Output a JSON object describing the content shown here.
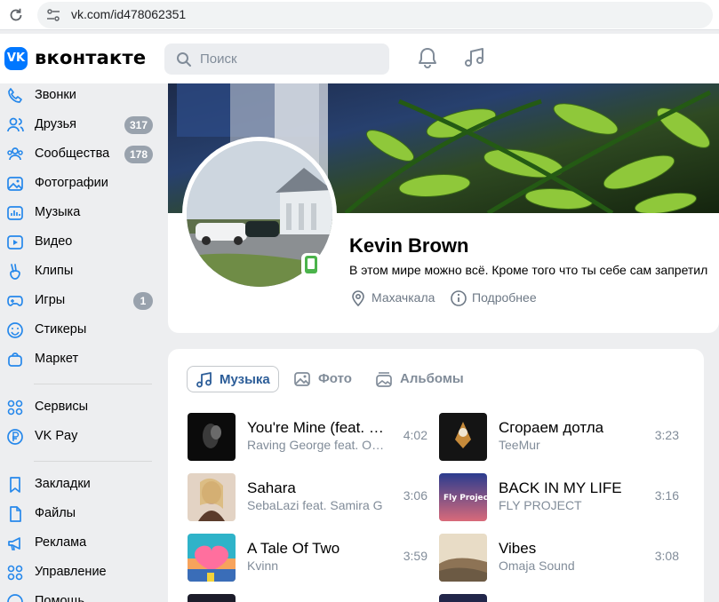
{
  "browser": {
    "url": "vk.com/id478062351"
  },
  "header": {
    "logo_mark": "VK",
    "logo_text": "вконтакте",
    "search_placeholder": "Поиск",
    "icons": [
      "notifications-bell-icon",
      "music-note-icon"
    ]
  },
  "sidebar": {
    "items": [
      {
        "label": "Звонки",
        "icon": "phone-icon"
      },
      {
        "label": "Друзья",
        "icon": "friends-icon",
        "badge": "317"
      },
      {
        "label": "Сообщества",
        "icon": "communities-icon",
        "badge": "178"
      },
      {
        "label": "Фотографии",
        "icon": "photos-icon"
      },
      {
        "label": "Музыка",
        "icon": "music-icon"
      },
      {
        "label": "Видео",
        "icon": "video-icon"
      },
      {
        "label": "Клипы",
        "icon": "clips-icon"
      },
      {
        "label": "Игры",
        "icon": "gamepad-icon",
        "badge": "1"
      },
      {
        "label": "Стикеры",
        "icon": "stickers-icon"
      },
      {
        "label": "Маркет",
        "icon": "market-bag-icon"
      },
      {
        "label": "Сервисы",
        "icon": "services-grid-icon"
      },
      {
        "label": "VK Pay",
        "icon": "vkpay-icon"
      },
      {
        "label": "Закладки",
        "icon": "bookmark-icon"
      },
      {
        "label": "Файлы",
        "icon": "file-icon"
      },
      {
        "label": "Реклама",
        "icon": "megaphone-icon"
      },
      {
        "label": "Управление",
        "icon": "manage-grid-icon"
      },
      {
        "label": "Помощь",
        "icon": "help-icon"
      }
    ]
  },
  "profile": {
    "name": "Kevin Brown",
    "status": "В этом мире можно всё. Кроме того что ты себе сам запретил",
    "city": "Махачкала",
    "more_link": "Подробнее"
  },
  "media": {
    "tabs": [
      {
        "label": "Музыка",
        "icon": "music-note-icon",
        "active": true
      },
      {
        "label": "Фото",
        "icon": "photo-icon",
        "active": false
      },
      {
        "label": "Альбомы",
        "icon": "albums-icon",
        "active": false
      }
    ],
    "tracks_left": [
      {
        "title": "You're Mine (feat. Fabricio)",
        "artist": "Raving George feat. Oscar",
        "duration": "4:02",
        "art_colors": [
          "#0b0b0b",
          "#3a3a3a"
        ]
      },
      {
        "title": "Sahara",
        "artist": "SebaLazi feat. Samira G",
        "duration": "3:06",
        "art_colors": [
          "#c9a58a",
          "#5b3b2b"
        ]
      },
      {
        "title": "A Tale Of Two",
        "artist": "Kvinn",
        "duration": "3:59",
        "art_colors": [
          "#ff6f9e",
          "#2fb3c9"
        ]
      }
    ],
    "tracks_right": [
      {
        "title": "Сгораем дотла",
        "artist": "TeeMur",
        "duration": "3:23",
        "art_colors": [
          "#141414",
          "#c68a3a"
        ]
      },
      {
        "title": "BACK IN MY LIFE",
        "artist": "FLY PROJECT",
        "duration": "3:16",
        "art_colors": [
          "#2b3c8f",
          "#d96a7a"
        ]
      },
      {
        "title": "Vibes",
        "artist": "Omaja Sound",
        "duration": "3:08",
        "art_colors": [
          "#d9c7a6",
          "#6c5a44"
        ]
      }
    ],
    "art_text": {
      "fly_project": "Fly Project"
    }
  },
  "colors": {
    "vk_blue": "#0077ff",
    "badge_gray": "#99a2ad",
    "online_green": "#4bb34b",
    "active_tab_text": "#2c5d98",
    "muted_text": "#818c99"
  }
}
